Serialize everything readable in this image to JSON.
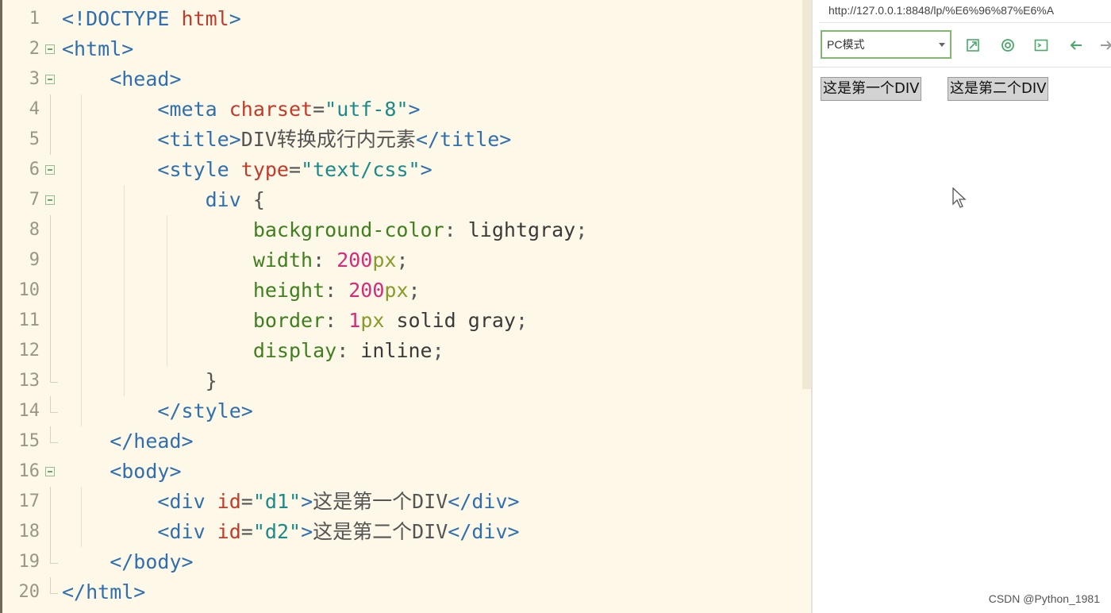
{
  "editor": {
    "lines": [
      {
        "n": "1",
        "segs": [
          [
            "<!DOCTYPE ",
            "tag"
          ],
          [
            "html",
            "attr"
          ],
          [
            ">",
            "tag"
          ]
        ]
      },
      {
        "n": "2",
        "segs": [
          [
            "<html>",
            "tag"
          ]
        ]
      },
      {
        "n": "3",
        "segs": [
          [
            "    <head>",
            "tag"
          ]
        ]
      },
      {
        "n": "4",
        "segs": [
          [
            "        <meta ",
            "tag"
          ],
          [
            "charset",
            "attr"
          ],
          [
            "=",
            "punct"
          ],
          [
            "\"utf-8\"",
            "str"
          ],
          [
            ">",
            "tag"
          ]
        ]
      },
      {
        "n": "5",
        "segs": [
          [
            "        <title>",
            "tag"
          ],
          [
            "DIV转换成行内元素",
            "text"
          ],
          [
            "</title>",
            "tag"
          ]
        ]
      },
      {
        "n": "6",
        "segs": [
          [
            "        <style ",
            "tag"
          ],
          [
            "type",
            "attr"
          ],
          [
            "=",
            "punct"
          ],
          [
            "\"text/css\"",
            "str"
          ],
          [
            ">",
            "tag"
          ]
        ]
      },
      {
        "n": "7",
        "segs": [
          [
            "            div ",
            "tag"
          ],
          [
            "{",
            "punct"
          ]
        ]
      },
      {
        "n": "8",
        "segs": [
          [
            "                background-color",
            "prop"
          ],
          [
            ": ",
            "punct"
          ],
          [
            "lightgray",
            "val"
          ],
          [
            ";",
            "punct"
          ]
        ]
      },
      {
        "n": "9",
        "segs": [
          [
            "                width",
            "prop"
          ],
          [
            ": ",
            "punct"
          ],
          [
            "200",
            "num"
          ],
          [
            "px",
            "unit"
          ],
          [
            ";",
            "punct"
          ]
        ]
      },
      {
        "n": "10",
        "segs": [
          [
            "                height",
            "prop"
          ],
          [
            ": ",
            "punct"
          ],
          [
            "200",
            "num"
          ],
          [
            "px",
            "unit"
          ],
          [
            ";",
            "punct"
          ]
        ]
      },
      {
        "n": "11",
        "segs": [
          [
            "                border",
            "prop"
          ],
          [
            ": ",
            "punct"
          ],
          [
            "1",
            "num"
          ],
          [
            "px",
            "unit"
          ],
          [
            " solid gray",
            "val"
          ],
          [
            ";",
            "punct"
          ]
        ]
      },
      {
        "n": "12",
        "segs": [
          [
            "                display",
            "prop"
          ],
          [
            ": ",
            "punct"
          ],
          [
            "inline",
            "val"
          ],
          [
            ";",
            "punct"
          ]
        ]
      },
      {
        "n": "13",
        "segs": [
          [
            "            }",
            "punct"
          ]
        ]
      },
      {
        "n": "14",
        "segs": [
          [
            "        </style>",
            "tag"
          ]
        ]
      },
      {
        "n": "15",
        "segs": [
          [
            "    </head>",
            "tag"
          ]
        ]
      },
      {
        "n": "16",
        "segs": [
          [
            "    <body>",
            "tag"
          ]
        ]
      },
      {
        "n": "17",
        "segs": [
          [
            "        <div ",
            "tag"
          ],
          [
            "id",
            "attr"
          ],
          [
            "=",
            "punct"
          ],
          [
            "\"d1\"",
            "str"
          ],
          [
            ">",
            "tag"
          ],
          [
            "这是第一个DIV",
            "text"
          ],
          [
            "</div>",
            "tag"
          ]
        ]
      },
      {
        "n": "18",
        "segs": [
          [
            "        <div ",
            "tag"
          ],
          [
            "id",
            "attr"
          ],
          [
            "=",
            "punct"
          ],
          [
            "\"d2\"",
            "str"
          ],
          [
            ">",
            "tag"
          ],
          [
            "这是第二个DIV",
            "text"
          ],
          [
            "</div>",
            "tag"
          ]
        ]
      },
      {
        "n": "19",
        "segs": [
          [
            "    </body>",
            "tag"
          ]
        ]
      },
      {
        "n": "20",
        "segs": [
          [
            "</html>",
            "tag"
          ]
        ]
      }
    ]
  },
  "preview": {
    "url": "http://127.0.0.1:8848/lp/%E6%96%87%E6%A",
    "mode_select": "PC模式",
    "toolbar_icons": [
      "open-external-icon",
      "settings-icon",
      "console-icon",
      "back-arrow-icon",
      "forward-arrow-icon"
    ],
    "div1_text": "这是第一个DIV",
    "div2_text": "这是第二个DIV"
  },
  "watermark": "CSDN @Python_1981",
  "colors": {
    "tag": "#2f6fb0",
    "attr": "#c23a2a",
    "string": "#1b8a8a",
    "property": "#3f7f1f",
    "number": "#d62a7a",
    "unit": "#8a9a2a",
    "editor_bg": "#fdf8e8",
    "div_bg": "#d3d3d3"
  }
}
